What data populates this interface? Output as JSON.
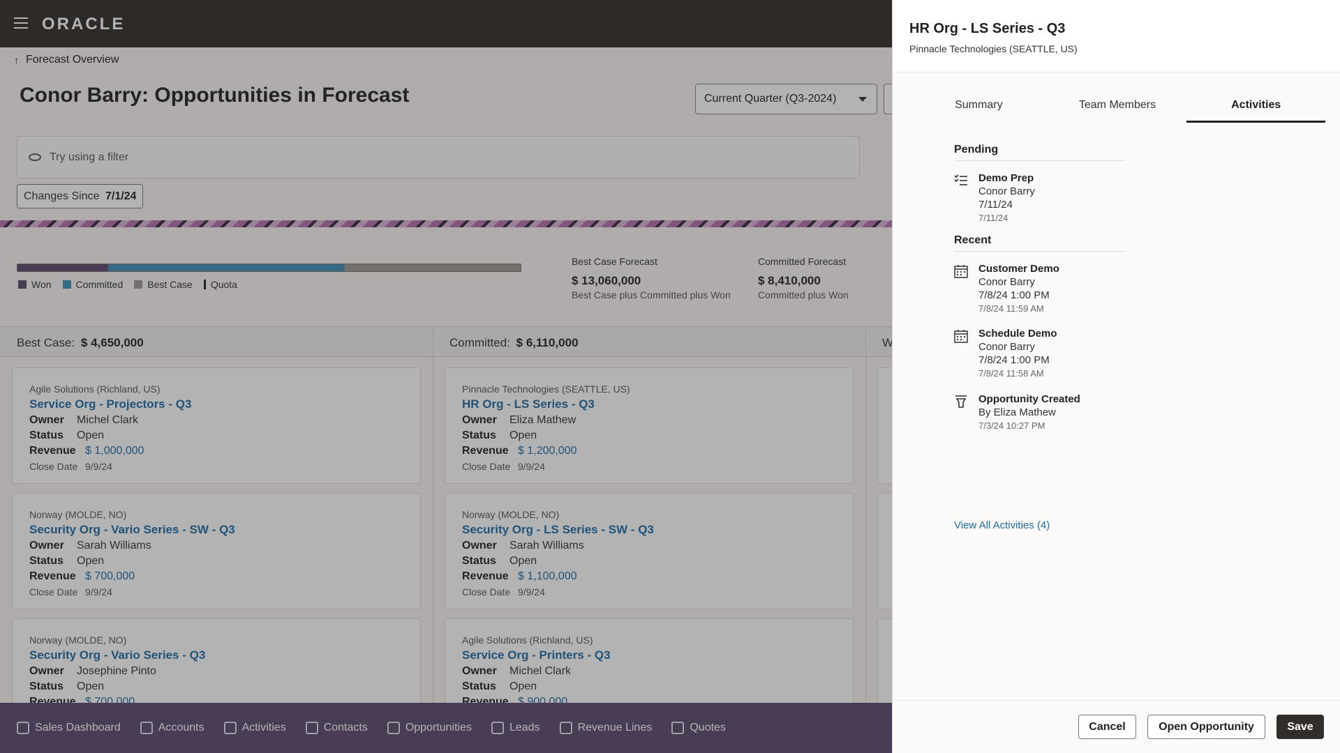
{
  "app": {
    "logo": "ORACLE"
  },
  "breadcrumb": {
    "label": "Forecast Overview"
  },
  "page": {
    "title": "Conor Barry: Opportunities in Forecast"
  },
  "period": {
    "selected": "Current Quarter (Q3-2024)"
  },
  "filter": {
    "placeholder": "Try using a filter"
  },
  "changes": {
    "label": "Changes Since",
    "date": "7/1/24"
  },
  "progress": {
    "won_fraction": 0.18,
    "committed_fraction": 0.47,
    "legend": [
      {
        "label": "Won",
        "color": "#5a4a6e"
      },
      {
        "label": "Committed",
        "color": "#3d8fb8"
      },
      {
        "label": "Best Case",
        "color": "#9c9894"
      },
      {
        "label": "Quota",
        "color": "#222222"
      }
    ]
  },
  "metrics": {
    "best_case": {
      "label": "Best Case Forecast",
      "value": "$ 13,060,000",
      "sub": "Best Case plus Committed plus Won"
    },
    "committed": {
      "label": "Committed Forecast",
      "value": "$ 8,410,000",
      "sub": "Committed plus Won"
    }
  },
  "columns": {
    "best_case": {
      "label": "Best Case:",
      "value": "$ 4,650,000"
    },
    "committed": {
      "label": "Committed:",
      "value": "$ 6,110,000"
    },
    "third": {
      "label": "W"
    }
  },
  "labels": {
    "owner": "Owner",
    "status": "Status",
    "revenue": "Revenue",
    "close_date": "Close Date"
  },
  "cards": {
    "best_case": [
      {
        "account": "Agile Solutions (Richland, US)",
        "title": "Service Org - Projectors - Q3",
        "owner": "Michel Clark",
        "status": "Open",
        "revenue": "$ 1,000,000",
        "close_date": "9/9/24"
      },
      {
        "account": "Norway (MOLDE, NO)",
        "title": "Security Org - Vario Series - SW - Q3",
        "owner": "Sarah Williams",
        "status": "Open",
        "revenue": "$ 700,000",
        "close_date": "9/9/24"
      },
      {
        "account": "Norway (MOLDE, NO)",
        "title": "Security Org - Vario Series - Q3",
        "owner": "Josephine Pinto",
        "status": "Open",
        "revenue": "$ 700,000"
      }
    ],
    "committed": [
      {
        "account": "Pinnacle Technologies (SEATTLE, US)",
        "title": "HR Org - LS Series - Q3",
        "owner": "Eliza Mathew",
        "status": "Open",
        "revenue": "$ 1,200,000",
        "close_date": "9/9/24"
      },
      {
        "account": "Norway (MOLDE, NO)",
        "title": "Security Org - LS Series - SW - Q3",
        "owner": "Sarah Williams",
        "status": "Open",
        "revenue": "$ 1,100,000",
        "close_date": "9/9/24"
      },
      {
        "account": "Agile Solutions (Richland, US)",
        "title": "Service Org - Printers - Q3",
        "owner": "Michel Clark",
        "status": "Open",
        "revenue": "$ 900,000"
      }
    ]
  },
  "bottom_nav": [
    {
      "label": "Sales Dashboard",
      "icon": "dashboard-icon"
    },
    {
      "label": "Accounts",
      "icon": "building-icon"
    },
    {
      "label": "Activities",
      "icon": "calendar-icon"
    },
    {
      "label": "Contacts",
      "icon": "contact-card-icon"
    },
    {
      "label": "Opportunities",
      "icon": "money-icon"
    },
    {
      "label": "Leads",
      "icon": "leads-icon"
    },
    {
      "label": "Revenue Lines",
      "icon": "cart-icon"
    },
    {
      "label": "Quotes",
      "icon": "document-icon"
    }
  ],
  "drawer": {
    "title": "HR Org - LS Series - Q3",
    "subtitle": "Pinnacle Technologies (SEATTLE, US)",
    "tabs": [
      "Summary",
      "Team Members",
      "Activities"
    ],
    "active_tab": "Activities",
    "pending_label": "Pending",
    "recent_label": "Recent",
    "pending": [
      {
        "icon": "task-list-icon",
        "title": "Demo Prep",
        "person": "Conor Barry",
        "when": "7/11/24",
        "timestamp": "7/11/24"
      }
    ],
    "recent": [
      {
        "icon": "calendar-icon",
        "title": "Customer Demo",
        "person": "Conor Barry",
        "when": "7/8/24 1:00 PM",
        "timestamp": "7/8/24 11:59 AM"
      },
      {
        "icon": "calendar-icon",
        "title": "Schedule Demo",
        "person": "Conor Barry",
        "when": "7/8/24 1:00 PM",
        "timestamp": "7/8/24 11:58 AM"
      },
      {
        "icon": "funnel-icon",
        "title": "Opportunity Created",
        "person": "By Eliza Mathew",
        "timestamp": "7/3/24 10:27 PM"
      }
    ],
    "view_all": "View All Activities (4)",
    "buttons": {
      "cancel": "Cancel",
      "open": "Open Opportunity",
      "save": "Save"
    }
  }
}
